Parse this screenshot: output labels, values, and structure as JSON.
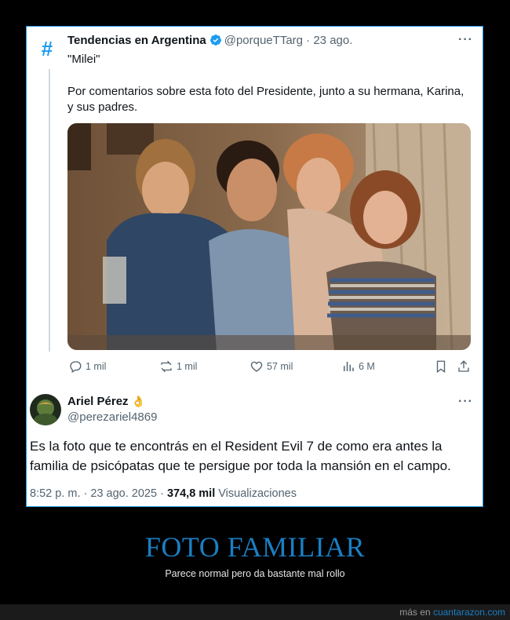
{
  "quoted": {
    "account_name": "Tendencias en Argentina",
    "handle": "@porqueTTarg",
    "separator": "·",
    "date": "23 ago.",
    "line1": "\"Milei\"",
    "line2": "Por comentarios sobre esta foto del Presidente, junto a su hermana, Karina,",
    "line3": "y sus padres.",
    "avatar_icon": "hashtag-icon",
    "accent": "#1d9bf0"
  },
  "actions": {
    "replies": "1 mil",
    "reposts": "1 mil",
    "likes": "57 mil",
    "views": "6 M"
  },
  "reply": {
    "name": "Ariel Pérez",
    "name_emoji": "👌",
    "handle": "@perezariel4869",
    "text": "Es la foto que te encontrás en el Resident Evil 7 de como era antes la familia de psicópatas que te persigue por toda la mansión en el campo.",
    "time": "8:52 p. m.",
    "date": "23 ago. 2025",
    "views_count": "374,8 mil",
    "views_label": "Visualizaciones",
    "sep": "·"
  },
  "post": {
    "title": "FOTO FAMILIAR",
    "subtitle": "Parece normal pero da bastante mal rollo"
  },
  "footer": {
    "prefix": "más en",
    "site": "cuantarazon.com"
  }
}
